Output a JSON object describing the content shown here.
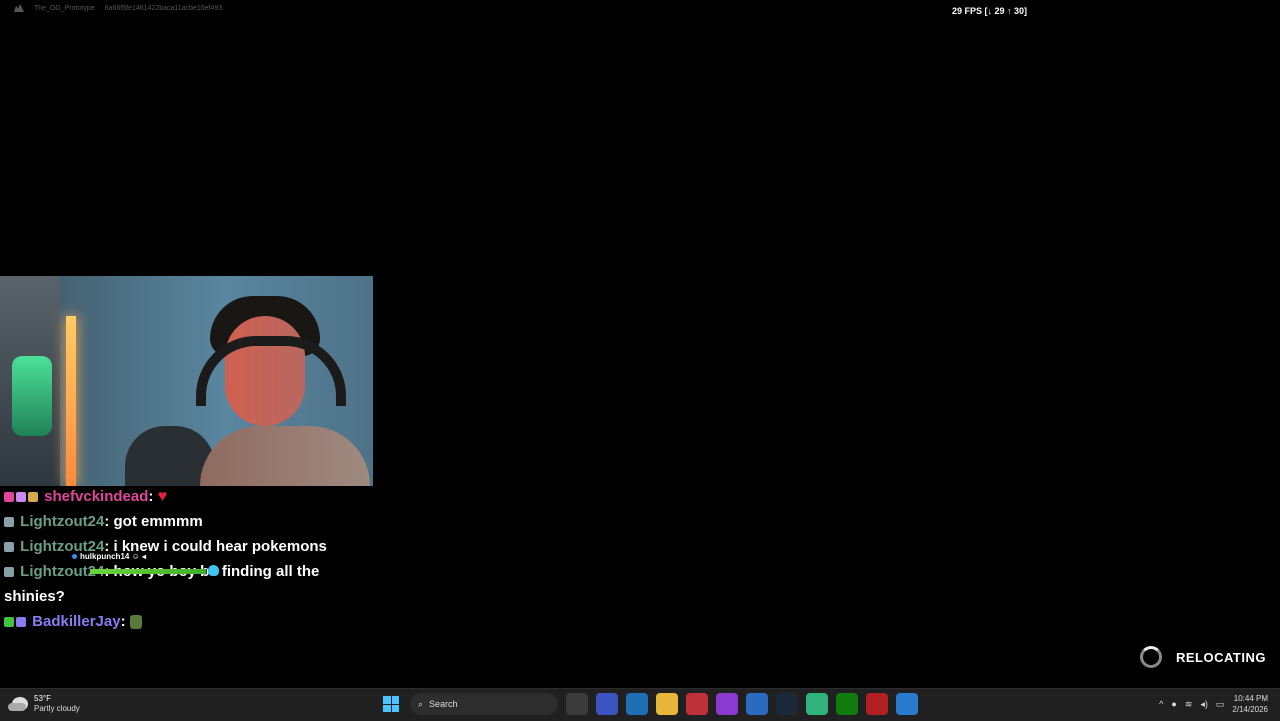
{
  "overlay": {
    "game_name": "The_OG_Prototype",
    "session_id": "6a66f5fe1461422baca11acbe10ef493",
    "fps_text": "29 FPS [↓ 29 ↑ 30]"
  },
  "chat": {
    "messages": [
      {
        "user": "shefvckindead",
        "text": "",
        "emote": "heart",
        "color": "#e0469a"
      },
      {
        "user": "Lightzout24",
        "text": "got emmmm",
        "color": "#6a9e8c"
      },
      {
        "user": "Lightzout24",
        "text": "i knew i could hear pokemons",
        "color": "#6a9e8c"
      },
      {
        "user": "Lightzout24",
        "text": "how yo boy be finding all the shinies?",
        "color": "#6a9e8c"
      },
      {
        "user": "BadkillerJay",
        "text": "",
        "emote": "sprite",
        "color": "#8a7cf0"
      }
    ]
  },
  "player": {
    "name": "hulkpunch14",
    "health": 0.99
  },
  "status": {
    "relocating": "RELOCATING"
  },
  "taskbar": {
    "weather_temp": "53°F",
    "weather_cond": "Partly cloudy",
    "search_placeholder": "Search",
    "time": "10:44 PM",
    "date": "2/14/2026"
  }
}
